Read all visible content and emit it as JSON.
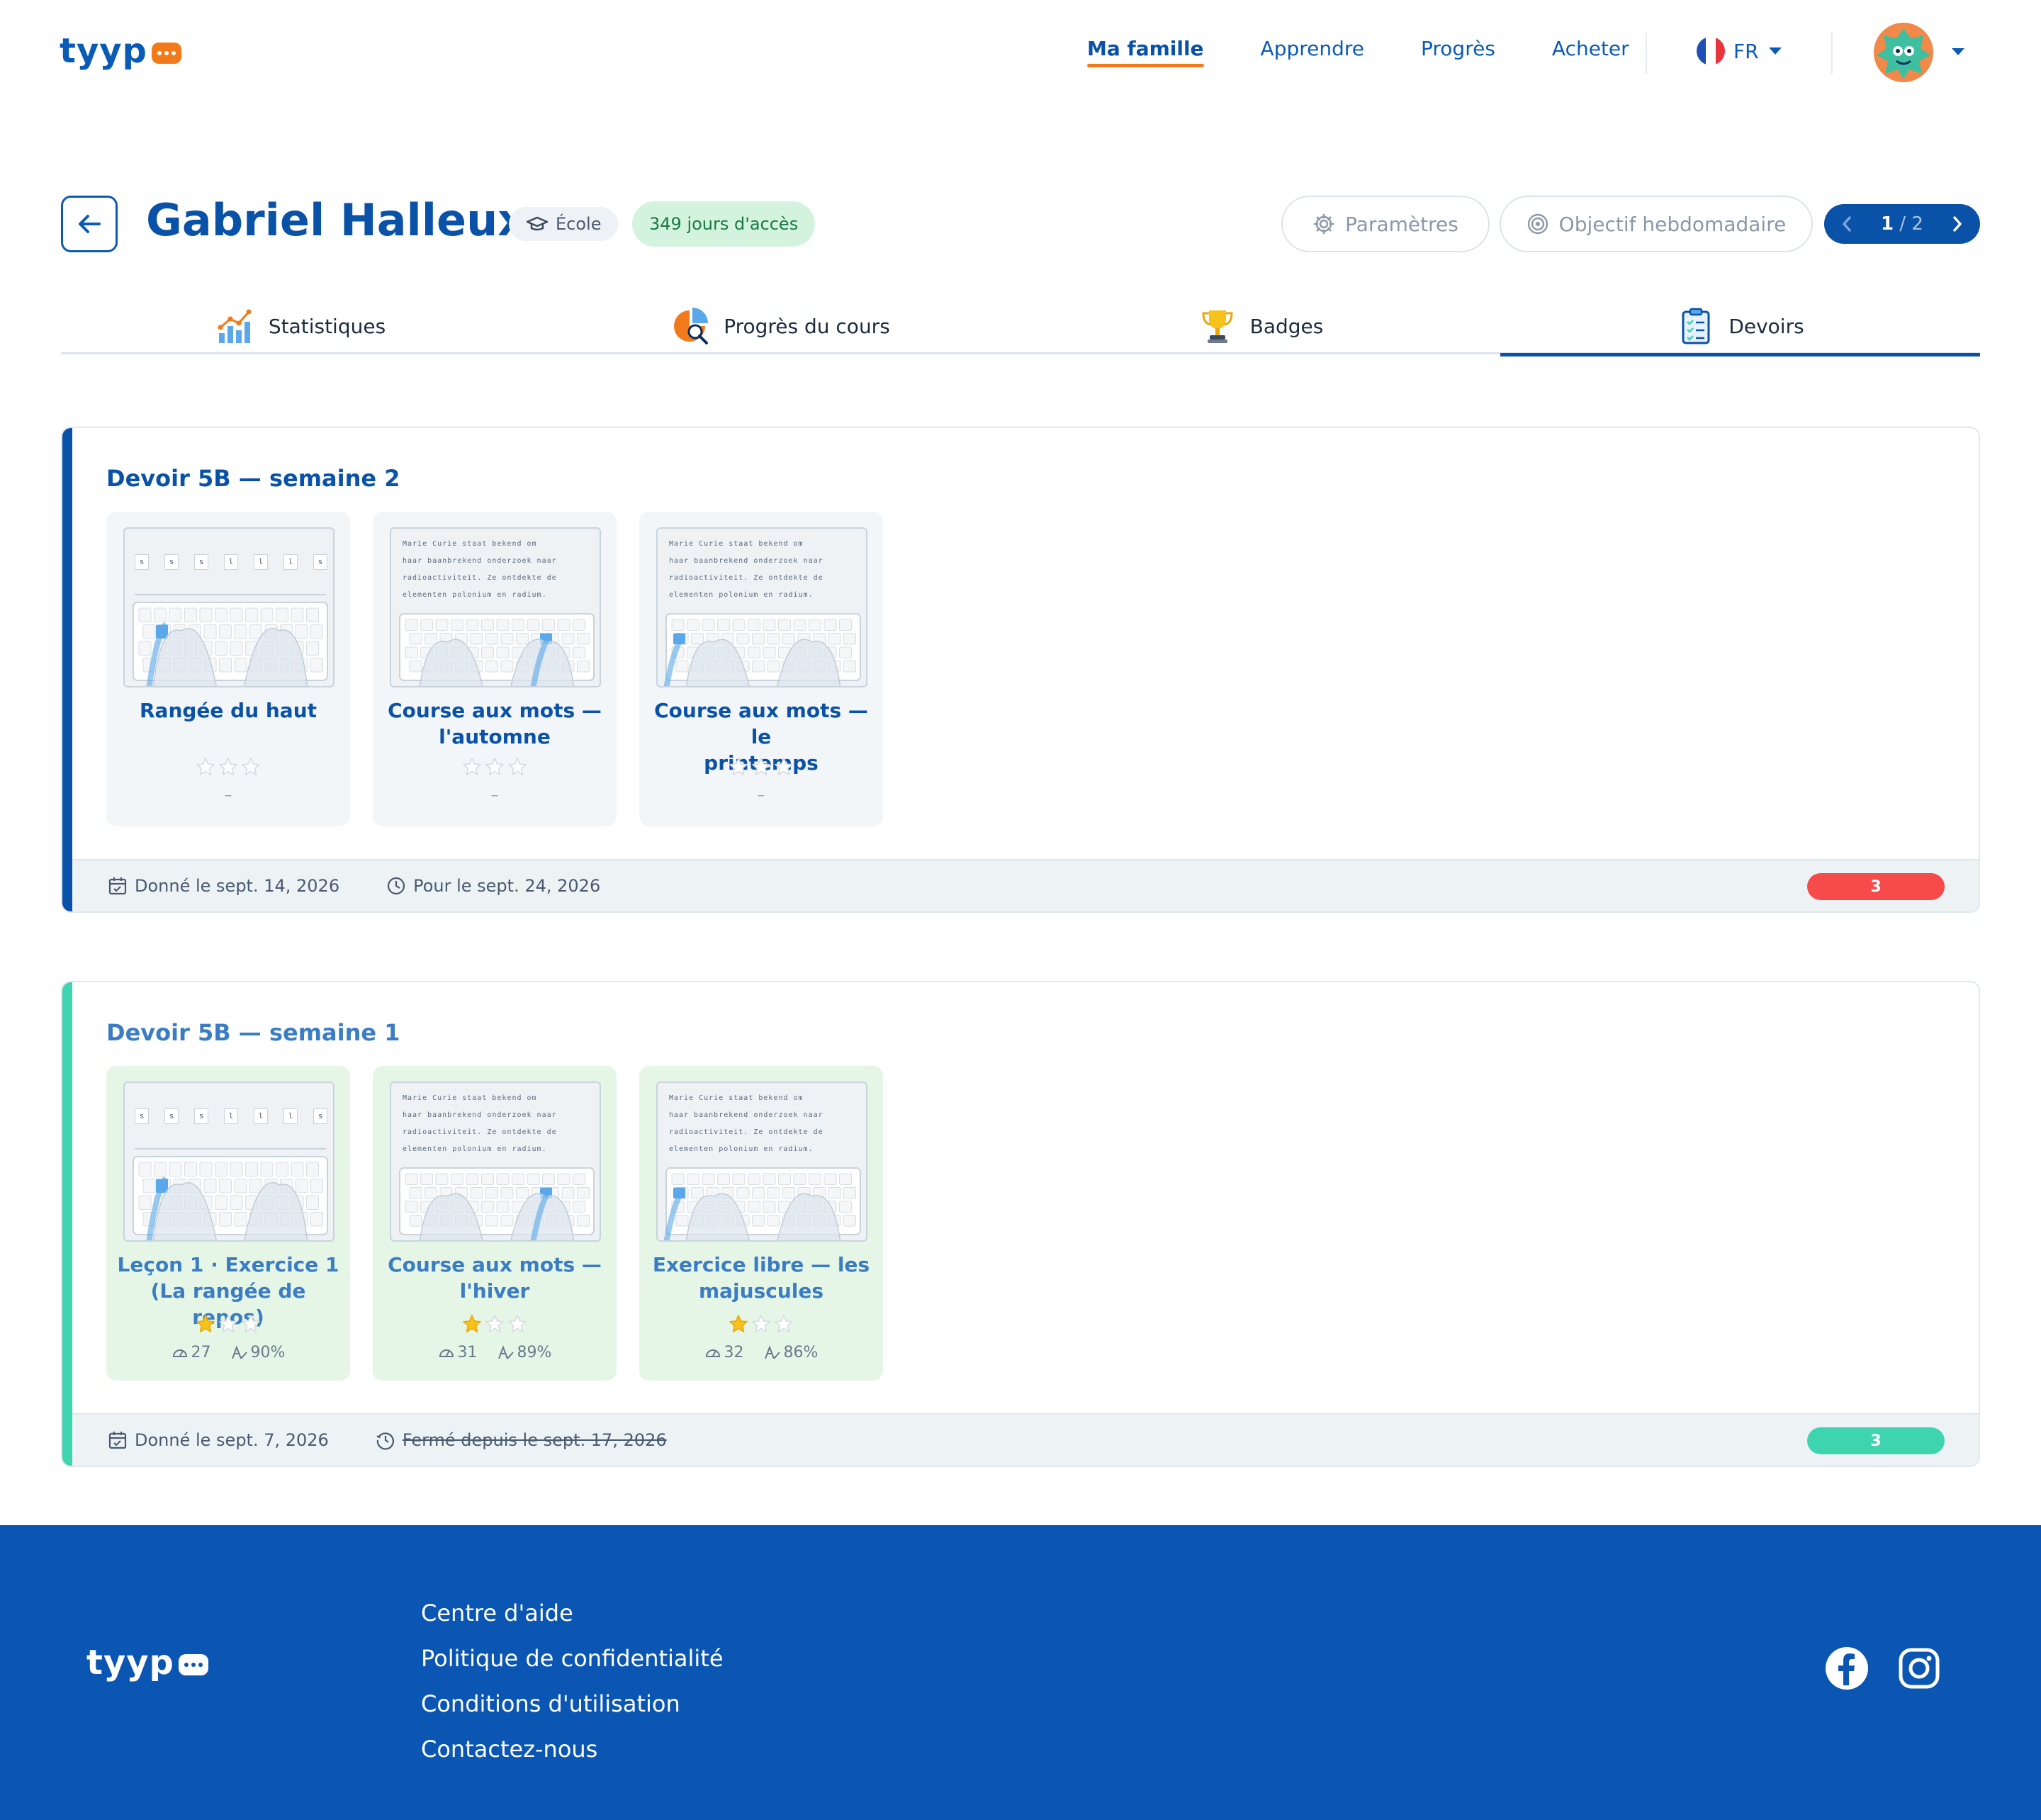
{
  "header": {
    "logo": "tyyp",
    "nav": [
      "Ma famille",
      "Apprendre",
      "Progrès",
      "Acheter"
    ],
    "active_nav": "Ma famille",
    "language": "FR",
    "colors": {
      "brand": "#0a52a8",
      "accent": "#f27a1a"
    }
  },
  "student": {
    "name": "Gabriel Halleux",
    "school_badge": "École",
    "access_badge": "349 jours d'accès"
  },
  "actions": {
    "settings": "Paramètres",
    "weekly_goal": "Objectif hebdomadaire",
    "page_current": "1",
    "page_total": "/ 2"
  },
  "tabs": [
    {
      "label": "Statistiques",
      "icon": "bar-chart-icon"
    },
    {
      "label": "Progrès du cours",
      "icon": "pie-magnifier-icon"
    },
    {
      "label": "Badges",
      "icon": "trophy-icon"
    },
    {
      "label": "Devoirs",
      "icon": "clipboard-icon",
      "active": true
    }
  ],
  "homework": [
    {
      "title": "Devoir 5B — semaine 2",
      "status_color": "#0a52a8",
      "lessons": [
        {
          "name_line1": "Rangée du haut",
          "name_line2": "",
          "stars": 0,
          "placeholder": "–"
        },
        {
          "name_line1": "Course aux mots —",
          "name_line2": "l'automne",
          "stars": 0,
          "placeholder": "–"
        },
        {
          "name_line1": "Course aux mots — le",
          "name_line2": "printemps",
          "stars": 0,
          "placeholder": "–"
        }
      ],
      "given": "Donné le sept. 14, 2026",
      "due": "Pour le sept. 24, 2026",
      "count": "3",
      "count_color": "#f74a4a"
    },
    {
      "title": "Devoir 5B — semaine 1",
      "status_color": "#3fd4b0",
      "lessons": [
        {
          "name_line1": "Leçon 1 · Exercice 1",
          "name_line2": "(La rangée de repos)",
          "stars": 1,
          "speed": "27",
          "accuracy": "90%"
        },
        {
          "name_line1": "Course aux mots —",
          "name_line2": "l'hiver",
          "stars": 1,
          "speed": "31",
          "accuracy": "89%"
        },
        {
          "name_line1": "Exercice libre — les",
          "name_line2": "majuscules",
          "stars": 1,
          "speed": "32",
          "accuracy": "86%"
        }
      ],
      "given": "Donné le sept. 7, 2026",
      "due": "Fermé depuis le sept. 17, 2026",
      "count": "3",
      "count_color": "#3fd4b0"
    }
  ],
  "thumb_text": {
    "line1": "Marie Curie staat bekend om",
    "line2": "haar baanbrekend onderzoek naar",
    "line3": "radioactiviteit. Ze ontdekte de",
    "line4": "elementen polonium en radium.",
    "keys": [
      "s",
      "s",
      "s",
      "l",
      "l",
      "l",
      "s"
    ]
  },
  "footer": {
    "logo": "tyyp",
    "links": [
      "Centre d'aide",
      "Politique de confidentialité",
      "Conditions d'utilisation",
      "Contactez-nous"
    ],
    "social": [
      "facebook-icon",
      "instagram-icon"
    ]
  }
}
